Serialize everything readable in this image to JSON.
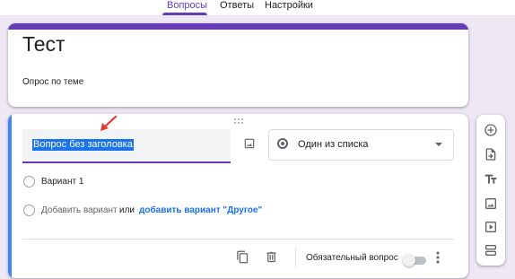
{
  "tabs": [
    {
      "label": "Вопросы",
      "active": true
    },
    {
      "label": "Ответы",
      "active": false
    },
    {
      "label": "Настройки",
      "active": false
    }
  ],
  "form": {
    "title": "Тест",
    "description": "Опрос по теме"
  },
  "question": {
    "title": "Вопрос без заголовка",
    "type": "Один из списка",
    "option1": "Вариант 1",
    "add_option": "Добавить вариант",
    "or": "или",
    "add_other": "добавить вариант \"Другое\"",
    "required_label": "Обязательный вопрос",
    "required": false
  },
  "toolbar_icons": [
    "add-question-icon",
    "import-questions-icon",
    "add-title-icon",
    "add-image-icon",
    "add-video-icon",
    "add-section-icon"
  ],
  "colors": {
    "accent": "#673ab7",
    "active_question": "#4285f4",
    "link": "#1a73e8",
    "annotation_arrow": "#e53935"
  }
}
